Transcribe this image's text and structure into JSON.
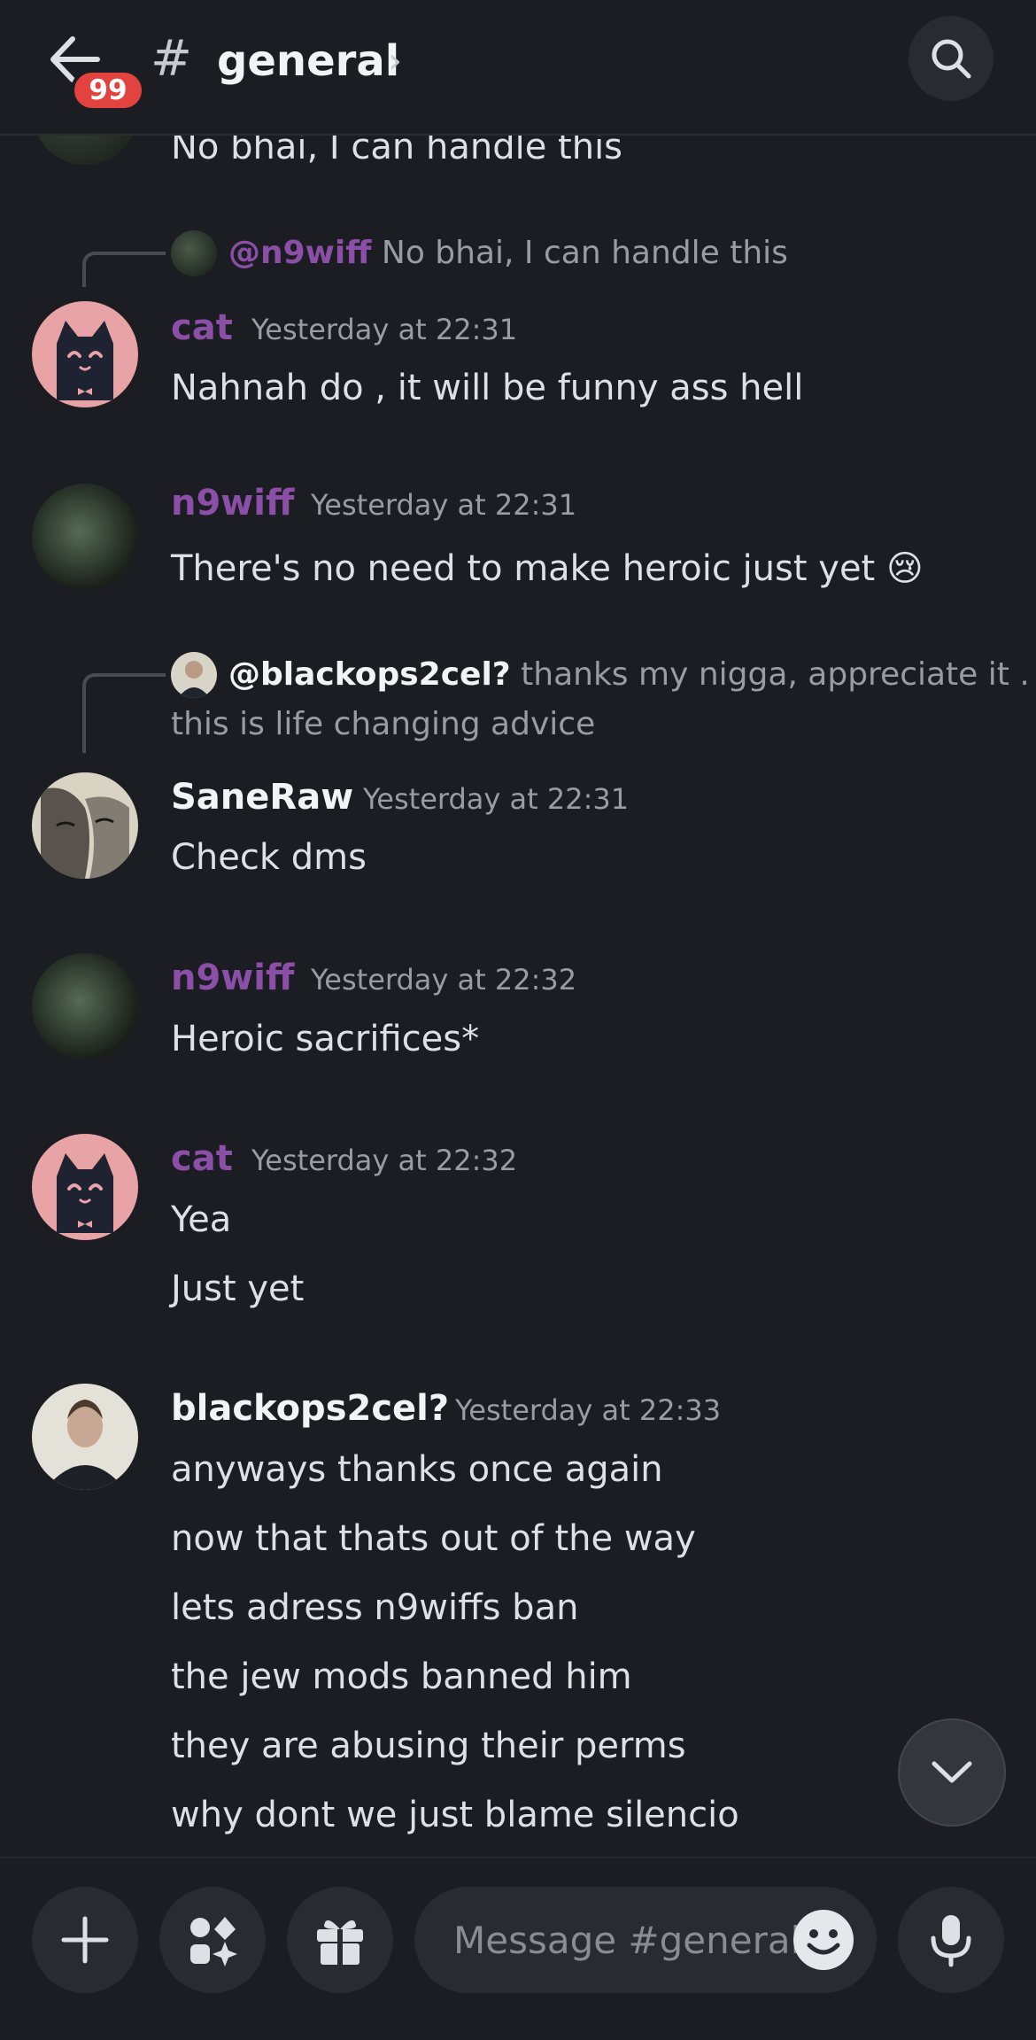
{
  "header": {
    "unread_count": "99",
    "hash": "#",
    "channel_name": "general",
    "chevron": "›",
    "back_icon": "arrow-left-icon",
    "search_icon": "search-icon"
  },
  "messages": {
    "partial_top": {
      "text": "No bhai, I can handle this"
    },
    "m1": {
      "reply_author": "@n9wiff",
      "reply_text": "No bhai, I can handle this",
      "author": "cat",
      "time": "Yesterday at 22:31",
      "lines": [
        "Nahnah do , it will be funny ass hell"
      ],
      "author_color": "#8c4fa8"
    },
    "m2": {
      "author": "n9wiff",
      "time": "Yesterday at 22:31",
      "lines": [
        "There's no need to make heroic just yet"
      ],
      "emoji": "😢",
      "author_color": "#8c4fa8"
    },
    "m3": {
      "reply_author": "@blackops2cel?",
      "reply_text": "thanks my nigga, appreciate it .",
      "reply_text_cont": "this is life changing advice",
      "author": "SaneRaw",
      "time": "Yesterday at 22:31",
      "lines": [
        "Check dms"
      ],
      "author_color": "#f2f3f5"
    },
    "m4": {
      "author": "n9wiff",
      "time": "Yesterday at 22:32",
      "lines": [
        "Heroic sacrifices*"
      ],
      "author_color": "#8c4fa8"
    },
    "m5": {
      "author": "cat",
      "time": "Yesterday at 22:32",
      "lines": [
        "Yea",
        "Just yet"
      ],
      "author_color": "#8c4fa8"
    },
    "m6": {
      "author": "blackops2cel?",
      "time": "Yesterday at 22:33",
      "lines": [
        "anyways thanks once again",
        "now that thats out of the way",
        "lets adress n9wiffs ban",
        "the jew mods banned him",
        "they are abusing their perms",
        "why dont we just blame silencio"
      ],
      "author_color": "#f2f3f5"
    }
  },
  "composer": {
    "placeholder": "Message #general",
    "buttons": [
      "plus-icon",
      "apps-icon",
      "gift-icon",
      "emoji-icon",
      "microphone-icon"
    ]
  },
  "scroll_down_icon": "chevron-down-icon"
}
